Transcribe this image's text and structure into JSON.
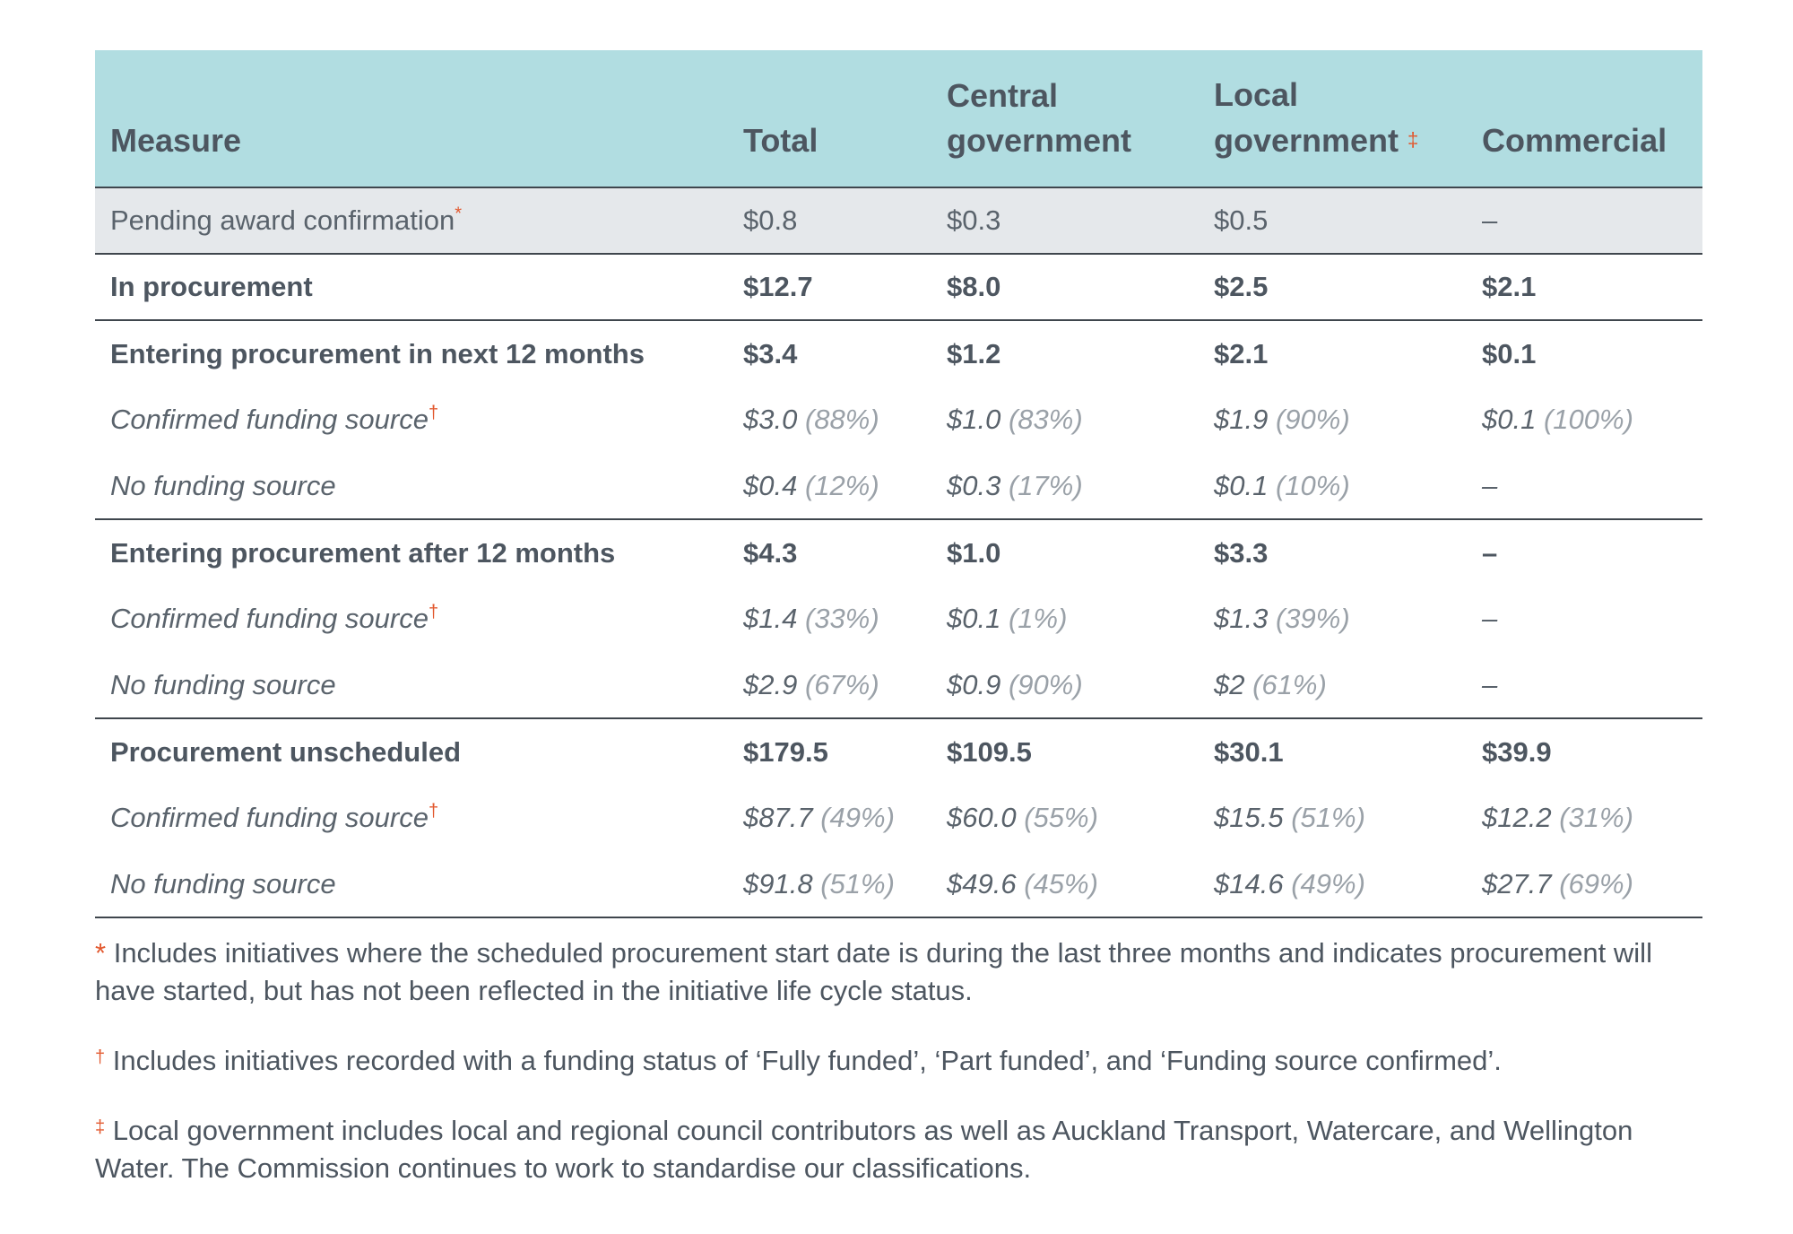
{
  "table": {
    "headers": [
      {
        "line1": "",
        "line2": "Measure"
      },
      {
        "line1": "",
        "line2": "Total"
      },
      {
        "line1": "Central",
        "line2": "government"
      },
      {
        "line1": "Local",
        "line2": "government",
        "mark": "‡"
      },
      {
        "line1": "",
        "line2": "Commercial"
      }
    ],
    "rows": [
      {
        "type": "pending",
        "label": "Pending award confirmation",
        "mark": "*",
        "cells": [
          {
            "value": "$0.8"
          },
          {
            "value": "$0.3"
          },
          {
            "value": "$0.5"
          },
          {
            "value": "–"
          }
        ]
      },
      {
        "type": "bold-sep",
        "label": "In procurement",
        "cells": [
          {
            "value": "$12.7"
          },
          {
            "value": "$8.0"
          },
          {
            "value": "$2.5"
          },
          {
            "value": "$2.1"
          }
        ]
      },
      {
        "type": "bold",
        "label": "Entering procurement in next 12 months",
        "cells": [
          {
            "value": "$3.4"
          },
          {
            "value": "$1.2"
          },
          {
            "value": "$2.1"
          },
          {
            "value": "$0.1"
          }
        ]
      },
      {
        "type": "sub",
        "label": "Confirmed funding source",
        "mark": "†",
        "cells": [
          {
            "value": "$3.0",
            "pct": "(88%)"
          },
          {
            "value": "$1.0",
            "pct": "(83%)"
          },
          {
            "value": "$1.9",
            "pct": "(90%)"
          },
          {
            "value": "$0.1",
            "pct": "(100%)"
          }
        ]
      },
      {
        "type": "sub-sep",
        "label": "No funding source",
        "cells": [
          {
            "value": "$0.4",
            "pct": "(12%)"
          },
          {
            "value": "$0.3",
            "pct": "(17%)"
          },
          {
            "value": "$0.1",
            "pct": "(10%)"
          },
          {
            "value": "–"
          }
        ]
      },
      {
        "type": "bold",
        "label": "Entering procurement after 12 months",
        "cells": [
          {
            "value": "$4.3"
          },
          {
            "value": "$1.0"
          },
          {
            "value": "$3.3"
          },
          {
            "value": "–"
          }
        ]
      },
      {
        "type": "sub",
        "label": "Confirmed funding source",
        "mark": "†",
        "cells": [
          {
            "value": "$1.4",
            "pct": "(33%)"
          },
          {
            "value": "$0.1",
            "pct": "(1%)"
          },
          {
            "value": "$1.3",
            "pct": "(39%)"
          },
          {
            "value": "–"
          }
        ]
      },
      {
        "type": "sub-sep",
        "label": "No funding source",
        "cells": [
          {
            "value": "$2.9",
            "pct": "(67%)"
          },
          {
            "value": "$0.9",
            "pct": "(90%)"
          },
          {
            "value": "$2",
            "pct": "(61%)"
          },
          {
            "value": "–"
          }
        ]
      },
      {
        "type": "bold",
        "label": "Procurement unscheduled",
        "cells": [
          {
            "value": "$179.5"
          },
          {
            "value": "$109.5"
          },
          {
            "value": "$30.1"
          },
          {
            "value": "$39.9"
          }
        ]
      },
      {
        "type": "sub",
        "label": "Confirmed funding source",
        "mark": "†",
        "cells": [
          {
            "value": "$87.7",
            "pct": "(49%)"
          },
          {
            "value": "$60.0",
            "pct": "(55%)"
          },
          {
            "value": "$15.5",
            "pct": "(51%)"
          },
          {
            "value": "$12.2",
            "pct": "(31%)"
          }
        ]
      },
      {
        "type": "sub-sep",
        "label": "No funding source",
        "cells": [
          {
            "value": "$91.8",
            "pct": "(51%)"
          },
          {
            "value": "$49.6",
            "pct": "(45%)"
          },
          {
            "value": "$14.6",
            "pct": "(49%)"
          },
          {
            "value": "$27.7",
            "pct": "(69%)"
          }
        ]
      }
    ]
  },
  "notes": [
    {
      "mark": "*",
      "text": "Includes initiatives where the scheduled procurement start date is during the last three months and indicates procurement will have started, but has not been reflected in the initiative life cycle status."
    },
    {
      "mark": "†",
      "text": "Includes initiatives recorded with a funding status of ‘Fully funded’, ‘Part funded’, and ‘Funding source confirmed’."
    },
    {
      "mark": "‡",
      "text": "Local government includes local and regional council contributors as well as Auckland Transport, Watercare, and Wellington Water. The Commission continues to work to standardise our classifications."
    }
  ],
  "colors": {
    "header_bg": "#b1dde1",
    "pending_bg": "#e5e8eb",
    "text": "#4d5660",
    "muted": "#9aa1a8",
    "accent": "#e2582e"
  }
}
